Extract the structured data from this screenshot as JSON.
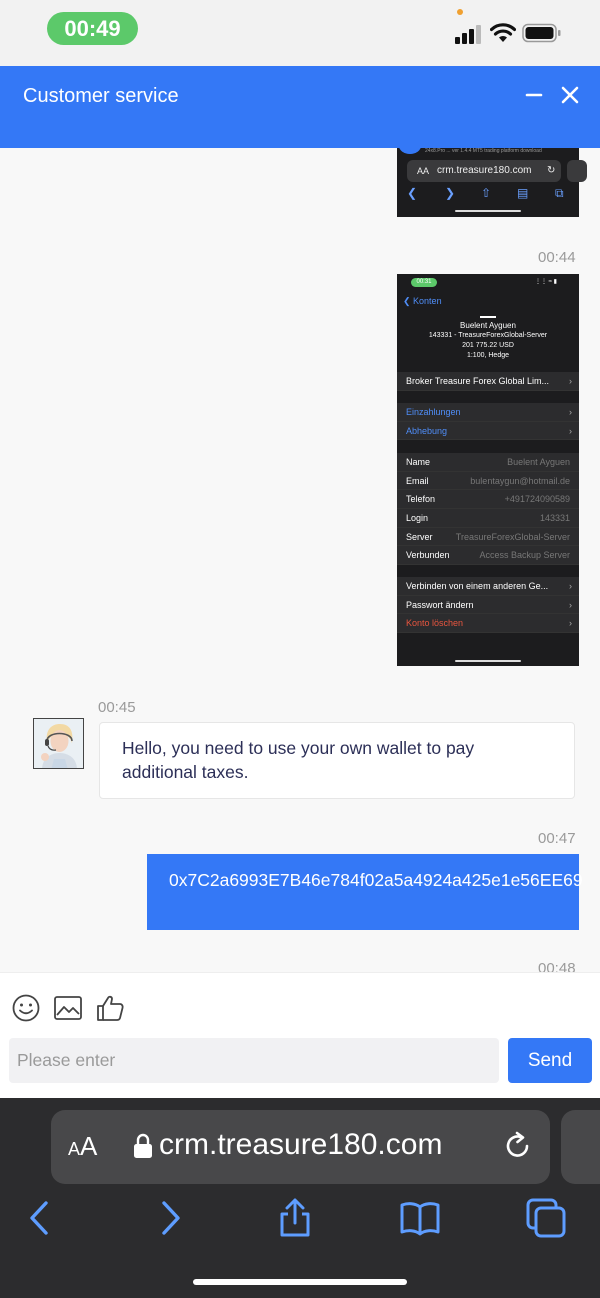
{
  "status_bar": {
    "time": "00:49"
  },
  "header": {
    "title": "Customer service"
  },
  "chat": {
    "screenshot1": {
      "tiny_text": "24x8.Pro ... ver 1.4.4     MT5 trading platform download",
      "aa": "AA",
      "url": "crm.treasure180.com",
      "reload": "↻"
    },
    "timestamp_1": "00:44",
    "screenshot2": {
      "time": "00:31",
      "back_label": "Konten",
      "name": "Buelent Ayguen",
      "server_line": "143331 - TreasureForexGlobal-Server",
      "balance": "201 775.22 USD",
      "leverage": "1:100, Hedge",
      "broker_row": "Broker  Treasure Forex Global Lim...",
      "deposit": "Einzahlungen",
      "withdraw": "Abhebung",
      "details": [
        {
          "label": "Name",
          "value": "Buelent Ayguen"
        },
        {
          "label": "Email",
          "value": "bulentaygun@hotmail.de"
        },
        {
          "label": "Telefon",
          "value": "+491724090589"
        },
        {
          "label": "Login",
          "value": "143331"
        },
        {
          "label": "Server",
          "value": "TreasureForexGlobal-Server"
        },
        {
          "label": "Verbunden",
          "value": "Access Backup Server"
        }
      ],
      "connect_other": "Verbinden von einem anderen Ge...",
      "change_password": "Passwort ändern",
      "delete_account": "Konto löschen"
    },
    "timestamp_2": "00:45",
    "agent_message": "Hello, you need to use your own wallet to pay additional taxes.",
    "timestamp_3": "00:47",
    "user_message": "0x7C2a6993E7B46e784f02a5a4924a425e1e56EE69",
    "timestamp_4": "00:48"
  },
  "composer": {
    "placeholder": "Please enter",
    "send_label": "Send"
  },
  "safari": {
    "aa_big": "A",
    "aa_small": "A",
    "url": "crm.treasure180.com"
  }
}
